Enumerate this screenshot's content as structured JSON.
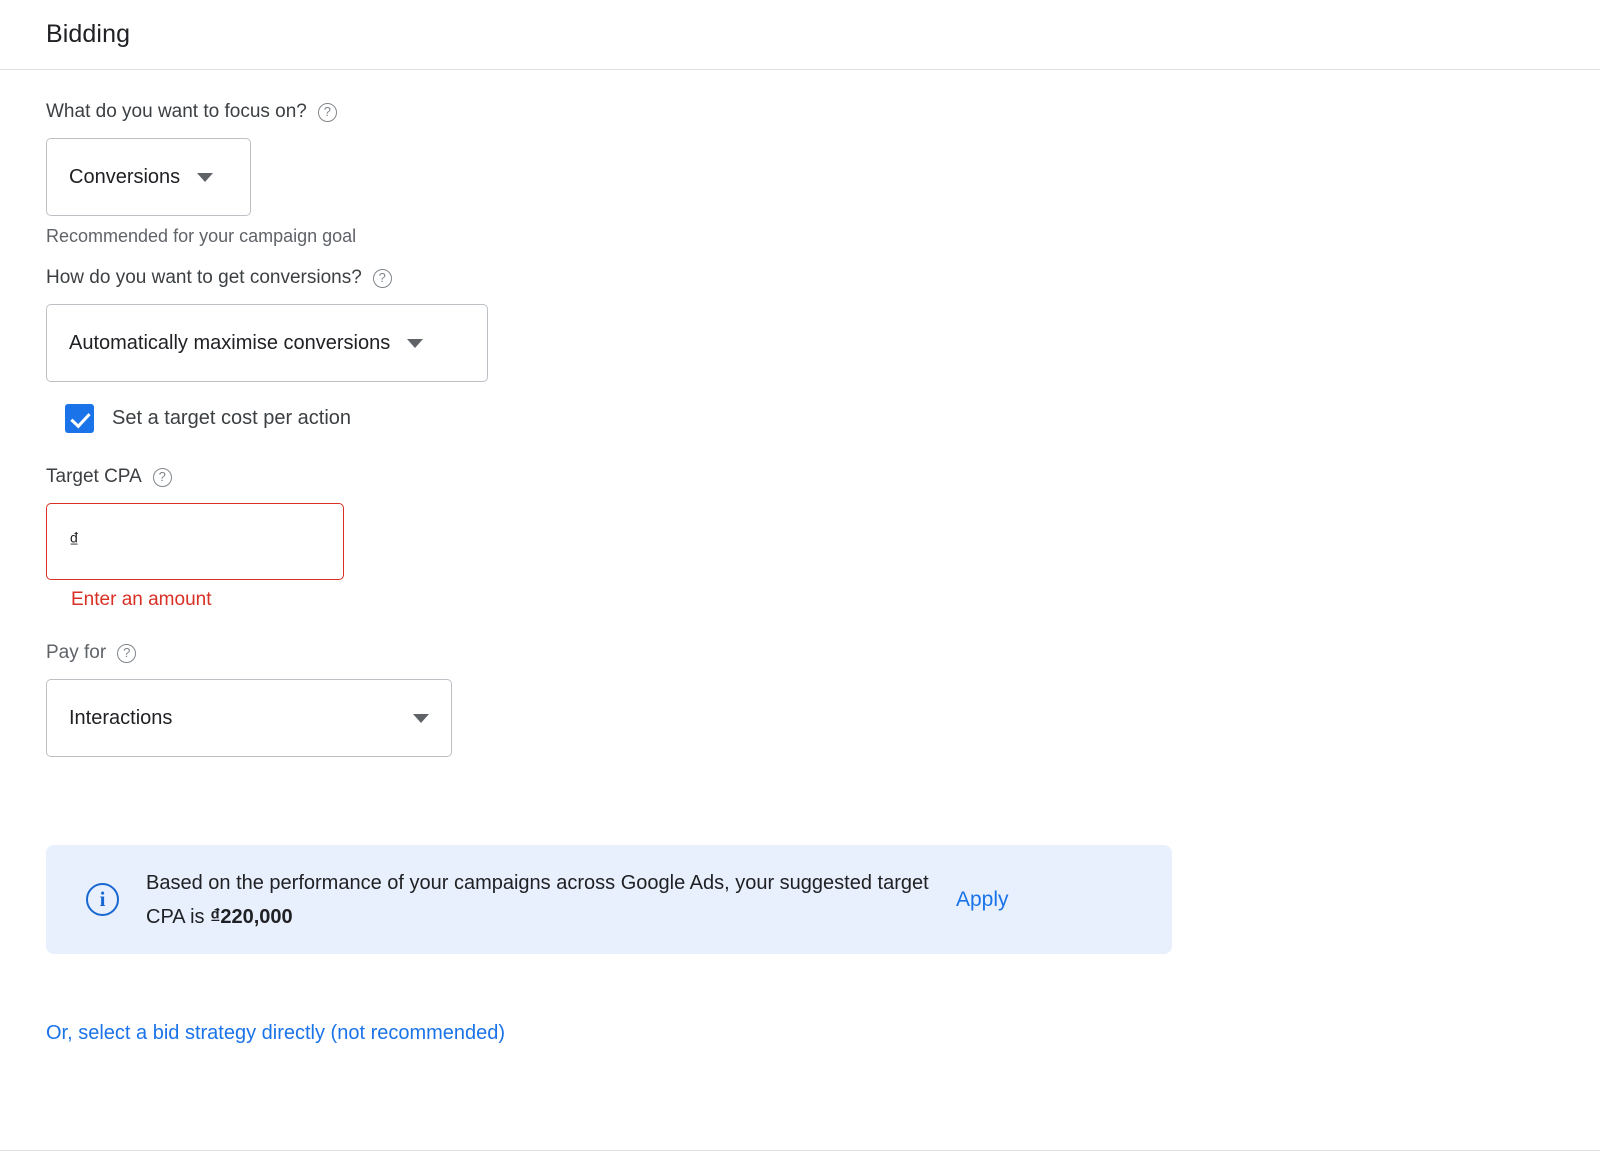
{
  "header": {
    "title": "Bidding"
  },
  "focus": {
    "label": "What do you want to focus on?",
    "help_icon": "help-circle-icon",
    "selected": "Conversions",
    "helper_text": "Recommended for your campaign goal"
  },
  "conversion_method": {
    "label": "How do you want to get conversions?",
    "help_icon": "help-circle-icon",
    "selected": "Automatically maximise conversions"
  },
  "target_cpa_checkbox": {
    "label": "Set a target cost per action",
    "checked": true,
    "accent_color": "#1a73e8"
  },
  "target_cpa": {
    "label": "Target CPA",
    "help_icon": "help-circle-icon",
    "value": "",
    "currency_symbol": "₫",
    "error_text": "Enter an amount",
    "error_color": "#d93025"
  },
  "pay_for": {
    "label": "Pay for",
    "help_icon": "help-circle-icon",
    "selected": "Interactions"
  },
  "info_banner": {
    "icon": "info-circle-icon",
    "text_part1": "Based on the performance of your campaigns across Google Ads, your suggested target CPA is ",
    "amount": "₫220,000",
    "apply_label": "Apply",
    "background_color": "#e8f0fe",
    "link_color": "#1a73e8"
  },
  "bottom_link": {
    "label": "Or, select a bid strategy directly (not recommended)",
    "color": "#1a73e8"
  },
  "icons": {
    "caret": "chevron-down-icon"
  }
}
